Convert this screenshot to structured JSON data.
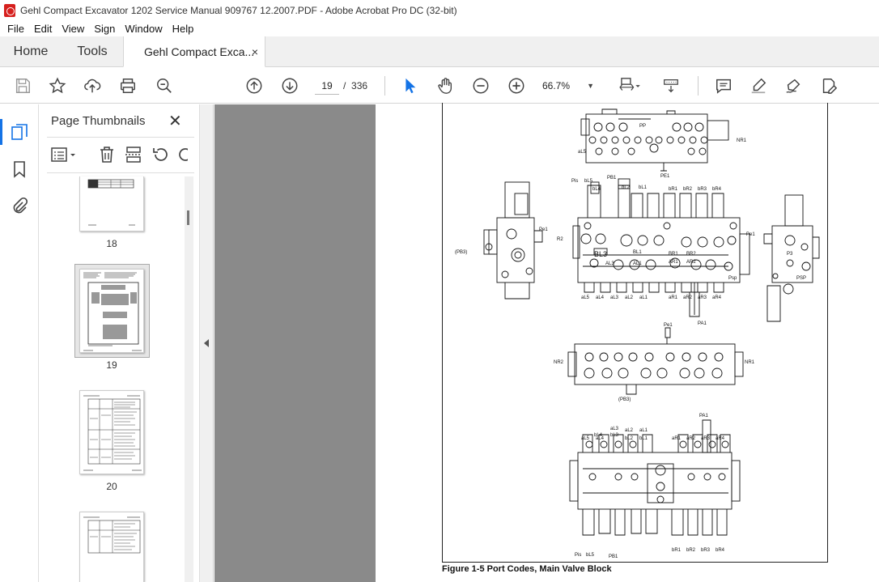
{
  "window": {
    "title": "Gehl Compact Excavator 1202 Service Manual 909767 12.2007.PDF - Adobe Acrobat Pro DC (32-bit)"
  },
  "menu": [
    "File",
    "Edit",
    "View",
    "Sign",
    "Window",
    "Help"
  ],
  "tabs": {
    "home": "Home",
    "tools": "Tools",
    "document": "Gehl Compact Exca...",
    "close": "×"
  },
  "toolbar": {
    "page_current": "19",
    "page_separator": "/",
    "page_total": "336",
    "zoom": "66.7%",
    "zoom_arrow": "▼"
  },
  "panel": {
    "title": "Page Thumbnails",
    "close": "✕",
    "thumbnails": [
      {
        "label": "18"
      },
      {
        "label": "19",
        "selected": true
      },
      {
        "label": "20"
      }
    ]
  },
  "document": {
    "caption": "Figure 1-5 Port Codes, Main Valve Block",
    "labels": {
      "top_view": [
        "PP",
        "NR1",
        "PE1",
        "aL5"
      ],
      "port_labels_top": [
        "Pis",
        "bL5",
        "PB1",
        "bL4",
        "bL2",
        "bL1",
        "bR1",
        "bR2",
        "bR3",
        "bR4"
      ],
      "port_labels_bottom": [
        "aL5",
        "aL4",
        "aL3",
        "aL2",
        "aL1",
        "aR1",
        "aR2",
        "aR3",
        "aR4"
      ],
      "side_left": [
        "(PB3)",
        "Pe1",
        "R2"
      ],
      "side_right": [
        "Pe1",
        "P3",
        "PSP"
      ],
      "center": [
        "BL3",
        "AL3",
        "BL1",
        "AL1",
        "BR1",
        "AR1",
        "BR2",
        "AR2",
        "PA1",
        "Psp"
      ],
      "mid_view": [
        "NR2",
        "NR1",
        "(PB3)",
        "Pe1"
      ],
      "bottom_view": [
        "PA1",
        "Pis",
        "bL5",
        "PB1",
        "bL4",
        "bL3",
        "bL2",
        "bL1",
        "bR1",
        "bR2",
        "bR3",
        "bR4",
        "aL5",
        "aL4",
        "aL3",
        "aL2",
        "aL1",
        "aR1",
        "aR2",
        "aR3",
        "aR4"
      ]
    }
  },
  "colors": {
    "accent": "#1473e6",
    "doc_bg": "#8a8a8a",
    "pdf_icon": "#d6201e"
  }
}
